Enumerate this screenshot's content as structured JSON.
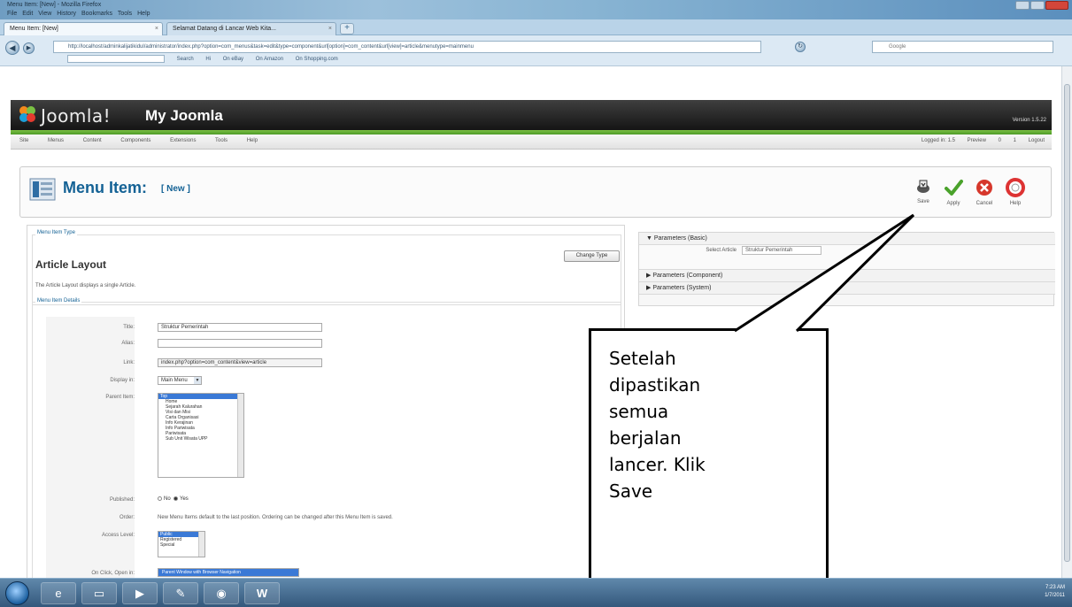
{
  "browser": {
    "window_title": "Menu Item: [New] - Mozilla Firefox",
    "menubar": [
      "File",
      "Edit",
      "View",
      "History",
      "Bookmarks",
      "Tools",
      "Help"
    ],
    "tabs": [
      {
        "label": "Menu Item: [New]",
        "active": true
      },
      {
        "label": "Selamat Datang di Lancar Web Kita...",
        "active": false
      }
    ],
    "url": "http://localhost/adminkalijatikidul/administrator/index.php?option=com_menus&task=edit&type=component&url[option]=com_content&url[view]=article&menutype=mainmenu",
    "search_placeholder": "Google",
    "bookmarks": [
      "Search",
      "Hi",
      "On eBay",
      "On Amazon",
      "On Shopping.com"
    ]
  },
  "joomla": {
    "logo_text": "Joomla!",
    "site_name": "My Joomla",
    "version": "Version 1.5.22",
    "menu": [
      "Site",
      "Menus",
      "Content",
      "Components",
      "Extensions",
      "Tools",
      "Help"
    ],
    "status": [
      "Logged in: 1.5",
      "Preview",
      "0",
      "1",
      "Logout"
    ],
    "page_title": "Menu Item:",
    "page_subtitle": "[ New ]",
    "toolbar": {
      "save": "Save",
      "apply": "Apply",
      "cancel": "Cancel",
      "help": "Help"
    },
    "menu_item_type_legend": "Menu Item Type",
    "layout_title": "Article Layout",
    "change_type_button": "Change Type",
    "layout_description": "The Article Layout displays a single Article.",
    "details_legend": "Menu Item Details",
    "fields": {
      "title_label": "Title:",
      "title_value": "Struktur Pemerintah",
      "alias_label": "Alias:",
      "alias_value": "",
      "link_label": "Link:",
      "link_value": "index.php?option=com_content&view=article",
      "display_in_label": "Display in:",
      "display_in_value": "Main Menu",
      "parent_label": "Parent Item:",
      "parent_options": [
        "Top",
        "Home",
        "Sejarah Kalurahan",
        "Visi dan Misi",
        "Carta Organisasi",
        "Info Kerajinan",
        "Info Pariwisata",
        "Pariwisata",
        "Sub Unit Wisata UPP"
      ],
      "published_label": "Published:",
      "published_no": "No",
      "published_yes": "Yes",
      "order_label": "Order:",
      "order_text": "New Menu Items default to the last position. Ordering can be changed after this Menu Item is saved.",
      "access_label": "Access Level:",
      "access_options": [
        "Public",
        "Registered",
        "Special"
      ],
      "onclick_label": "On Click, Open in:",
      "onclick_value": "Parent Window with Browser Navigation"
    },
    "params": {
      "basic": "Parameters (Basic)",
      "select_article_label": "Select Article",
      "select_article_value": "Struktur Pemerintah",
      "component": "Parameters (Component)",
      "system": "Parameters (System)"
    }
  },
  "callout": {
    "lines": [
      "Setelah",
      "dipastikan",
      "semua",
      "berjalan",
      "lancer. Klik",
      "Save"
    ]
  },
  "taskbar": {
    "time": "7:23 AM",
    "date": "1/7/2011",
    "apps": [
      "ie",
      "folder",
      "media",
      "paint",
      "firefox",
      "word"
    ]
  }
}
